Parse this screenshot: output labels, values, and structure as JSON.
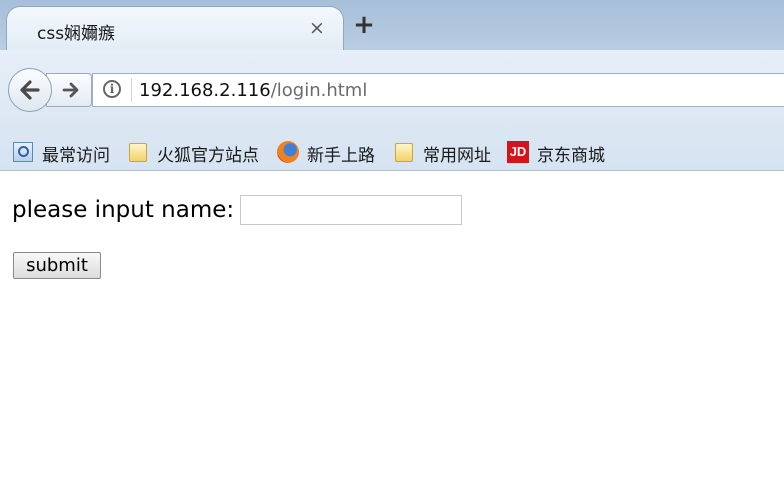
{
  "tab": {
    "title": "css娴嬭瘯",
    "close_glyph": "×",
    "new_tab_glyph": "+"
  },
  "nav": {
    "back_icon": "back-arrow-icon",
    "forward_icon": "forward-arrow-icon",
    "info_glyph": "i",
    "url_host": "192.168.2.116",
    "url_path": "/login.html"
  },
  "bookmarks": [
    {
      "label": "最常访问",
      "icon": "most-visited-icon"
    },
    {
      "label": "火狐官方站点",
      "icon": "folder-icon"
    },
    {
      "label": "新手上路",
      "icon": "firefox-icon"
    },
    {
      "label": "常用网址",
      "icon": "folder-icon"
    },
    {
      "label": "京东商城",
      "icon": "jd-icon",
      "icon_text": "JD"
    }
  ],
  "form": {
    "label": "please input name:",
    "input_value": "",
    "submit_label": "submit"
  },
  "colors": {
    "chrome_blue": "#dbe6f3",
    "jd_red": "#d2141b"
  }
}
